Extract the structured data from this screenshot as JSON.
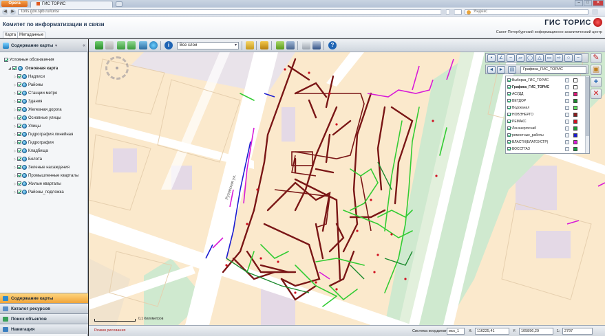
{
  "browser": {
    "menu_button": "Opera",
    "tab_title": "ГИС ТОРИС",
    "url": "toris.gov.spb.ru/toris/",
    "search_placeholder": "Яндекс"
  },
  "app": {
    "title": "Комитет по информатизации и связи",
    "logo_text": "ГИС ТОРИС",
    "subtitle": "Санкт-Петербургский информационно-аналитический центр",
    "menu_tabs": [
      "Карта",
      "Метаданные"
    ]
  },
  "left_panel": {
    "header": "Содержание карты",
    "legend_checkbox": "Условные обозначения",
    "root_layer": "Основная карта",
    "layers": [
      "Надписи",
      "Районы",
      "Станции метро",
      "Здания",
      "Железная дорога",
      "Основные улицы",
      "Улицы",
      "Гидрография линейная",
      "Гидрография",
      "Кладбища",
      "Болота",
      "Зеленые насаждения",
      "Промышленные кварталы",
      "Жилые кварталы",
      "Районы_подложка"
    ],
    "accordion": [
      "Содержание карты",
      "Каталог ресурсов",
      "Поиск объектов",
      "Навигация"
    ]
  },
  "toolbar": {
    "layer_select": "Все слои"
  },
  "map": {
    "street_label": "Рузовская ул.",
    "scale_label": "0,1 Километров"
  },
  "draw_panel": {
    "active_layer": "Графика_ГИС_ТОРИС",
    "layers": [
      {
        "name": "Выборка_ГИС_ТОРИС",
        "color": "#ffffff"
      },
      {
        "name": "Графика_ГИС_ТОРИС",
        "color": "#ffffff",
        "selected": true
      },
      {
        "name": "АСУДД",
        "color": "#e0177a"
      },
      {
        "name": "ВЕТДОР",
        "color": "#1c8a2e"
      },
      {
        "name": "Водоканал",
        "color": "#5fe05f"
      },
      {
        "name": "НОВЭНЕРГО",
        "color": "#8a1c1c"
      },
      {
        "name": "РЕМАКС",
        "color": "#d01020"
      },
      {
        "name": "Ленэнергоснаб",
        "color": "#1c9a2e"
      },
      {
        "name": "ремонтные_работы",
        "color": "#1b1bd0"
      },
      {
        "name": "ВЛАСТИ(БЛАГОУСТР)",
        "color": "#d81bd8"
      },
      {
        "name": "ВОССТГАЗ",
        "color": "#12a040"
      }
    ]
  },
  "status": {
    "left_text": "Режим рисования",
    "coord_label": "Система координат:",
    "coord_system": "мск_1",
    "x_label": "X:",
    "x_value": "116225,41",
    "y_label": "Y:",
    "y_value": "105896,29",
    "scale_label": "1:",
    "scale_value": "2797"
  },
  "colors": {
    "map_bg": "#fbe9cc",
    "street": "#ffffff",
    "green_space": "#cfe9cf",
    "accent_active": "#f0a43a"
  }
}
